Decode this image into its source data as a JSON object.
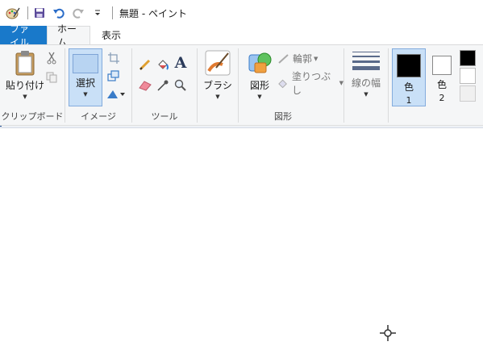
{
  "window": {
    "title": "無題 - ペイント"
  },
  "quick_access": {
    "icons": [
      "paint-app-icon",
      "save-icon",
      "undo-icon",
      "redo-icon",
      "customize-dropdown-icon"
    ]
  },
  "tabs": [
    {
      "label": "ファイル"
    },
    {
      "label": "ホーム"
    },
    {
      "label": "表示"
    }
  ],
  "ribbon": {
    "clipboard": {
      "group_label": "クリップボード",
      "paste_label": "貼り付け"
    },
    "image": {
      "group_label": "イメージ",
      "select_label": "選択"
    },
    "tools": {
      "group_label": "ツール"
    },
    "brushes": {
      "label": "ブラシ"
    },
    "shapes": {
      "group_label": "図形",
      "shapes_label": "図形",
      "outline_label": "輪郭",
      "fill_label": "塗りつぶし"
    },
    "size": {
      "label": "線の幅"
    },
    "colors": {
      "color1_label": "色",
      "color1_num": "1",
      "color2_label": "色",
      "color2_num": "2",
      "color1": "#000000",
      "color2": "#ffffff"
    }
  },
  "colors": {
    "accent": "#1979ca",
    "ribbon_bg": "#f5f6f7",
    "selected_bg": "#c9e0f7"
  }
}
